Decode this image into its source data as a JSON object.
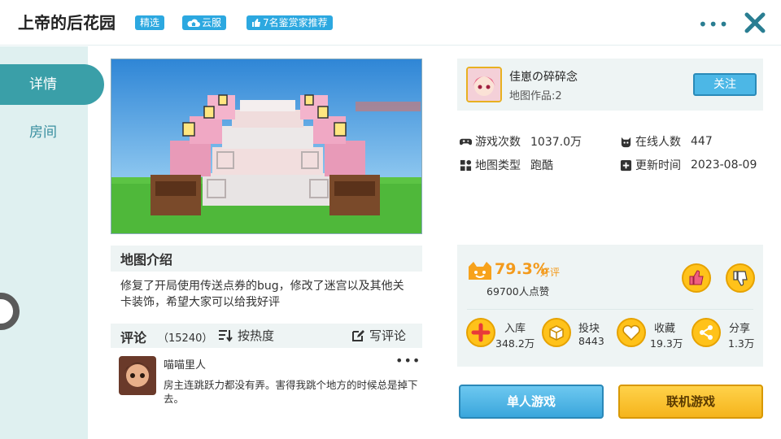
{
  "header": {
    "title": "上帝的后花园",
    "badges": [
      "精选",
      "云服",
      "7名鉴赏家推荐"
    ],
    "more_label": "•••"
  },
  "sidebar": {
    "tabs": [
      {
        "label": "详情",
        "active": true
      },
      {
        "label": "房间",
        "active": false
      }
    ]
  },
  "intro": {
    "title": "地图介绍",
    "text": "修复了开局使用传送点券的bug，修改了迷宫以及其他关卡装饰，希望大家可以给我好评"
  },
  "comments": {
    "label": "评论",
    "count": "（15240）",
    "sort_label": "按热度",
    "write_label": "写评论",
    "items": [
      {
        "user": "喵喵里人",
        "text": "房主连跳跃力都没有弄。害得我跳个地方的时候总是掉下去。"
      }
    ]
  },
  "author": {
    "name": "佳崽の碎碎念",
    "works": "地图作品:2",
    "follow_label": "关注"
  },
  "stats": {
    "plays_label": "游戏次数",
    "plays_value": "1037.0万",
    "online_label": "在线人数",
    "online_value": "447",
    "type_label": "地图类型",
    "type_value": "跑酷",
    "updated_label": "更新时间",
    "updated_value": "2023-08-09"
  },
  "rating": {
    "percent": "79.3%",
    "word": "好评",
    "count": "69700人点赞"
  },
  "actions": [
    {
      "label": "入库",
      "value": "348.2万",
      "icon": "plus-icon"
    },
    {
      "label": "投块",
      "value": "8443",
      "icon": "block-icon"
    },
    {
      "label": "收藏",
      "value": "19.3万",
      "icon": "heart-icon"
    },
    {
      "label": "分享",
      "value": "1.3万",
      "icon": "share-icon"
    }
  ],
  "buttons": {
    "single": "单人游戏",
    "multi": "联机游戏"
  },
  "colors": {
    "accent": "#3a9fa8",
    "badge": "#2ca8e0",
    "rating": "#f39a1c",
    "single_button": "#3aa6dc",
    "multi_button": "#f5b41c"
  }
}
